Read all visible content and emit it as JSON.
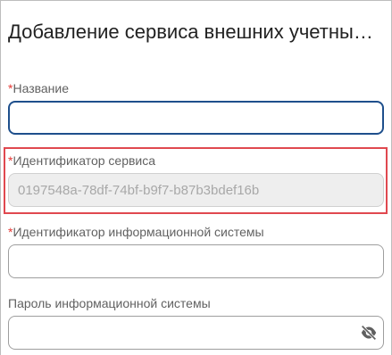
{
  "dialog": {
    "title": "Добавление сервиса внешних учетных записей"
  },
  "fields": {
    "name": {
      "required_mark": "*",
      "label": "Название",
      "value": "",
      "placeholder": ""
    },
    "service_id": {
      "required_mark": "*",
      "label": "Идентификатор сервиса",
      "value": "0197548a-78df-74bf-b9f7-b87b3bdef16b"
    },
    "info_system_id": {
      "required_mark": "*",
      "label": "Идентификатор информационной системы",
      "value": ""
    },
    "info_system_password": {
      "label": "Пароль информационной системы",
      "value": "",
      "visibility_icon": "eye-off-icon"
    }
  },
  "colors": {
    "required": "#e53935",
    "focus_border": "#1e4f8c",
    "highlight": "#e0484f"
  }
}
